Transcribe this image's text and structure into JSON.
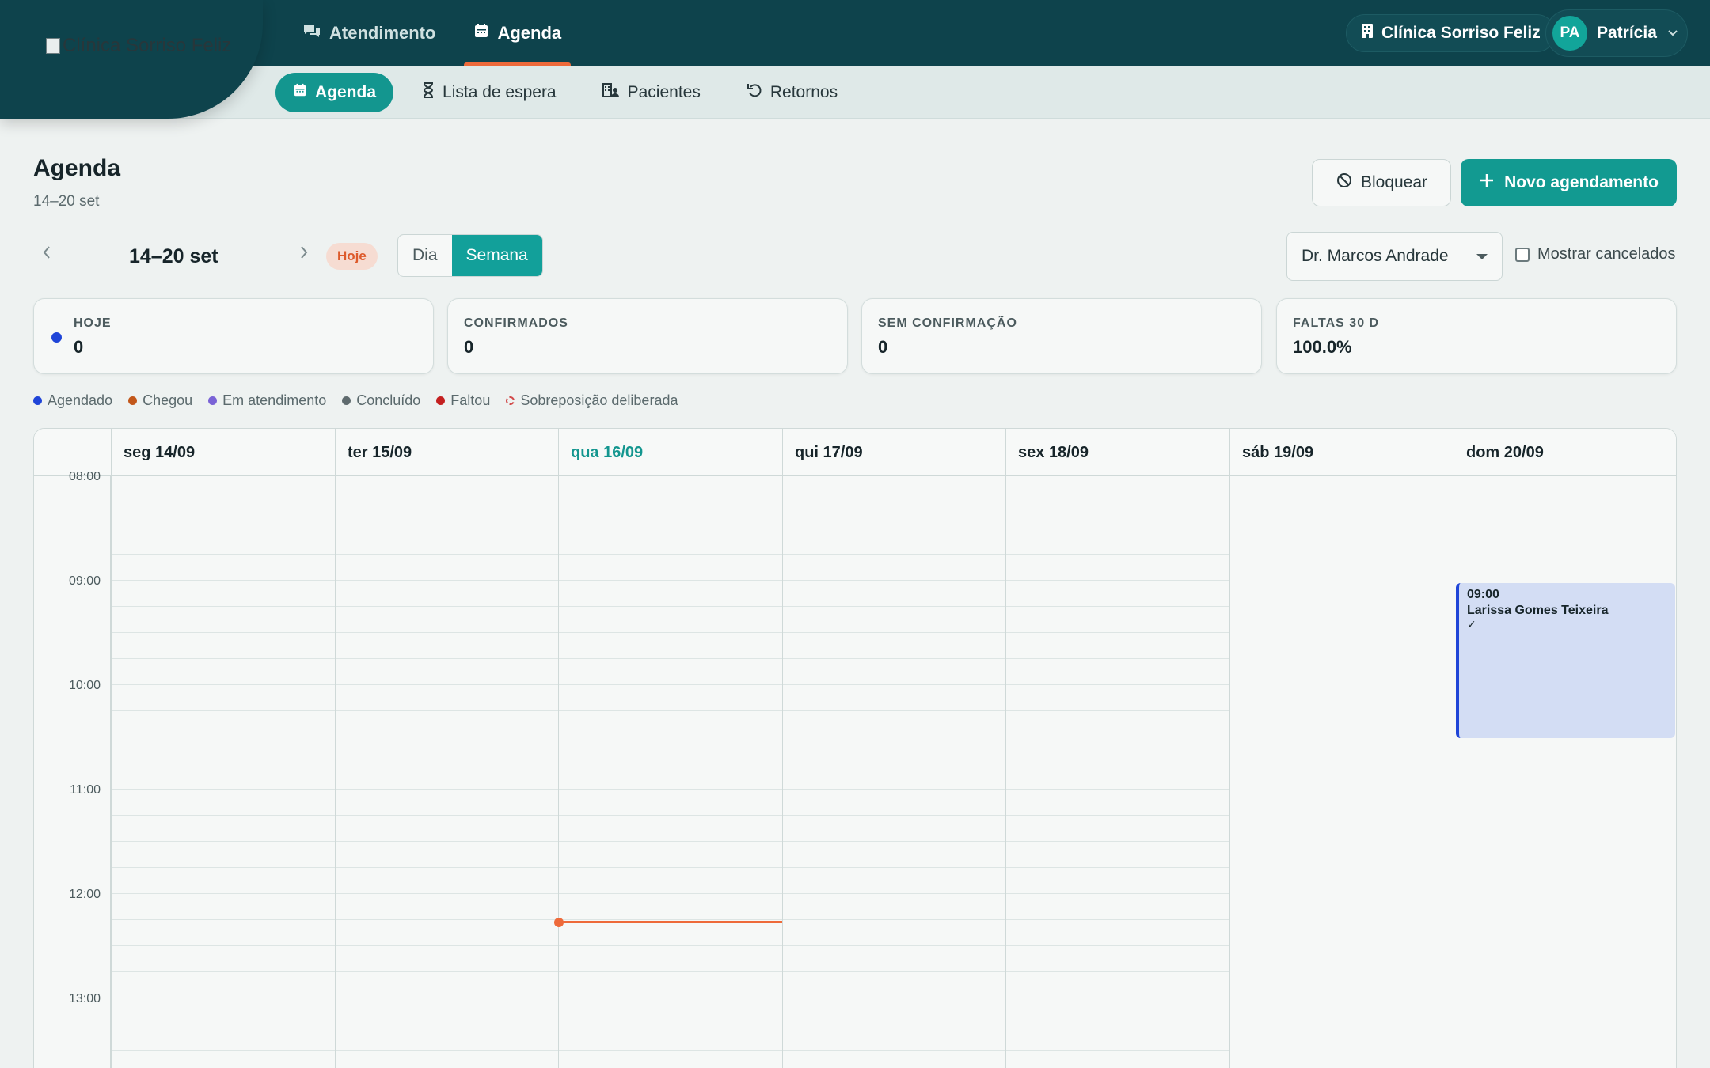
{
  "topbar": {
    "logo_alt": "Clínica Sorriso Feliz",
    "nav": [
      {
        "label": "Atendimento",
        "icon": "chat-icon"
      },
      {
        "label": "Agenda",
        "icon": "calendar-icon"
      }
    ],
    "clinic": "Clínica Sorriso Feliz",
    "user": {
      "initials": "PA",
      "name": "Patrícia"
    }
  },
  "subnav": [
    {
      "label": "Agenda",
      "icon": "calendar-icon"
    },
    {
      "label": "Lista de espera",
      "icon": "hourglass-icon"
    },
    {
      "label": "Pacientes",
      "icon": "patients-icon"
    },
    {
      "label": "Retornos",
      "icon": "undo-icon"
    }
  ],
  "header": {
    "title": "Agenda",
    "subtitle": "14–20 set",
    "block_label": "Bloquear",
    "new_label": "Novo agendamento"
  },
  "toolbar": {
    "range": "14–20 set",
    "today": "Hoje",
    "views": [
      "Dia",
      "Semana"
    ],
    "active_view": "Semana",
    "doctor": "Dr. Marcos Andrade",
    "show_cancelled": "Mostrar cancelados"
  },
  "stats": [
    {
      "label": "HOJE",
      "value": "0"
    },
    {
      "label": "CONFIRMADOS",
      "value": "0"
    },
    {
      "label": "SEM CONFIRMAÇÃO",
      "value": "0"
    },
    {
      "label": "FALTAS 30 D",
      "value": "100.0%"
    }
  ],
  "legend": [
    {
      "label": "Agendado",
      "color": "#1f45d8"
    },
    {
      "label": "Chegou",
      "color": "#c2571a"
    },
    {
      "label": "Em atendimento",
      "color": "#7a63d6"
    },
    {
      "label": "Concluído",
      "color": "#5f6b6e"
    },
    {
      "label": "Faltou",
      "color": "#c42020"
    },
    {
      "label": "Sobreposição deliberada",
      "color": "#d24a4a"
    }
  ],
  "calendar": {
    "days": [
      "seg 14/09",
      "ter 15/09",
      "qua 16/09",
      "qui 17/09",
      "sex 18/09",
      "sáb 19/09",
      "dom 20/09"
    ],
    "today_index": 2,
    "times": [
      "08:00",
      "09:00",
      "10:00",
      "11:00",
      "12:00",
      "13:00"
    ],
    "now_time": "12:15",
    "events": [
      {
        "day": "dom 20/09",
        "time": "09:00",
        "end": "10:30",
        "patient": "Larissa Gomes Teixeira",
        "status": "Agendado",
        "confirmed_mark": "✓"
      }
    ]
  }
}
